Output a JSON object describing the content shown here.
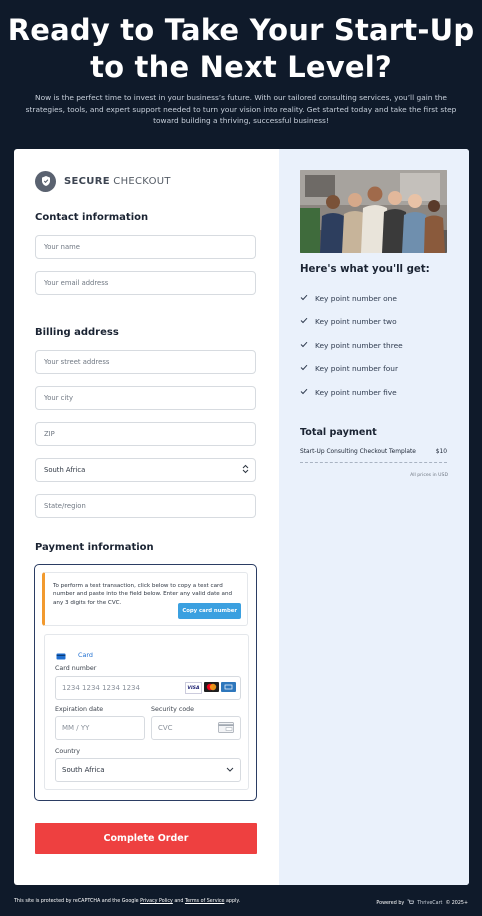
{
  "hero": {
    "title": "Ready to Take Your Start-Up to the Next Level?",
    "subtitle": "Now is the perfect time to invest in your business’s future. With our tailored consulting services, you’ll gain the strategies, tools, and expert support needed to turn your vision into reality. Get started today and take the first step toward building a thriving, successful business!"
  },
  "checkout": {
    "secure_bold": "SECURE",
    "secure_rest": " CHECKOUT",
    "contact_title": "Contact information",
    "name_placeholder": "Your name",
    "email_placeholder": "Your email address",
    "billing_title": "Billing address",
    "street_placeholder": "Your street address",
    "city_placeholder": "Your city",
    "zip_placeholder": "ZIP",
    "country_value": "South Africa",
    "state_placeholder": "State/region",
    "payment_title": "Payment information",
    "notice_text": "To perform a test transaction, click below to copy a test card number and paste into the field below. Enter any valid date and any 3 digits for the CVC.",
    "copy_button": "Copy card number",
    "card_tab": "Card",
    "card_number_label": "Card number",
    "card_number_placeholder": "1234 1234 1234 1234",
    "expiry_label": "Expiration date",
    "expiry_placeholder": "MM / YY",
    "cvc_label": "Security code",
    "cvc_placeholder": "CVC",
    "country_label": "Country",
    "country_select": "South Africa",
    "complete_button": "Complete Order"
  },
  "summary": {
    "benefits_title": "Here's what you'll get:",
    "benefits": [
      "Key point number one",
      "Key point number two",
      "Key point number three",
      "Key point number four",
      "Key point number five"
    ],
    "total_title": "Total payment",
    "item_name": "Start-Up Consulting Checkout Template",
    "item_price": "$10",
    "currency_note": "All prices in USD"
  },
  "footer": {
    "left_prefix": "This site is protected by reCAPTCHA and the Google ",
    "privacy": "Privacy Policy",
    "and": " and ",
    "terms": "Terms of Service",
    "apply": " apply.",
    "powered": "Powered by",
    "brand": "ThriveCart",
    "copyright": "© 2025+"
  },
  "colors": {
    "page_bg": "#0f1a2a",
    "accent_button": "#ee4040",
    "copy_button": "#3ba0e0",
    "summary_bg": "#eaf1fb",
    "payment_border": "#2b3d63"
  }
}
